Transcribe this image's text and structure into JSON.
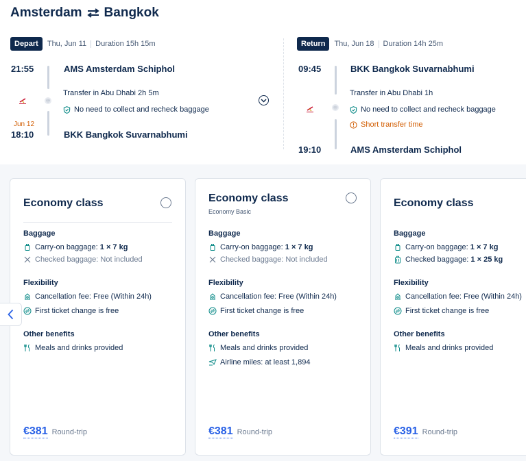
{
  "route": {
    "origin": "Amsterdam",
    "destination": "Bangkok",
    "swap_icon": "swap-arrows-icon"
  },
  "depart": {
    "badge": "Depart",
    "date": "Thu, Jun 11",
    "duration": "Duration 15h 15m",
    "dep_time": "21:55",
    "dep_airport": "AMS Amsterdam Schiphol",
    "transfer": "Transfer in Abu Dhabi  2h 5m",
    "baggage_note": "No need to collect and recheck baggage",
    "arr_nextday": "Jun 12",
    "arr_time": "18:10",
    "arr_airport": "BKK Bangkok Suvarnabhumi"
  },
  "return": {
    "badge": "Return",
    "date": "Thu, Jun 18",
    "duration": "Duration 14h 25m",
    "dep_time": "09:45",
    "dep_airport": "BKK Bangkok Suvarnabhumi",
    "transfer": "Transfer in Abu Dhabi  1h",
    "baggage_note": "No need to collect and recheck baggage",
    "warning": "Short transfer time",
    "arr_time": "19:10",
    "arr_airport": "AMS Amsterdam Schiphol"
  },
  "cards": [
    {
      "title": "Economy class",
      "subtitle": "",
      "baggage_head": "Baggage",
      "carry_label": "Carry-on baggage: ",
      "carry_value": "1 × 7 kg",
      "checked_label": "Checked baggage: Not included",
      "checked_value": "",
      "flex_head": "Flexibility",
      "cancel": "Cancellation fee: Free (Within 24h)",
      "change": "First ticket change is free",
      "other_head": "Other benefits",
      "meals": "Meals and drinks provided",
      "miles": "",
      "price": "€381",
      "price_note": "Round-trip"
    },
    {
      "title": "Economy class",
      "subtitle": "Economy Basic",
      "baggage_head": "Baggage",
      "carry_label": "Carry-on baggage: ",
      "carry_value": "1 × 7 kg",
      "checked_label": "Checked baggage: Not included",
      "checked_value": "",
      "flex_head": "Flexibility",
      "cancel": "Cancellation fee: Free (Within 24h)",
      "change": "First ticket change is free",
      "other_head": "Other benefits",
      "meals": "Meals and drinks provided",
      "miles": "Airline miles: at least 1,894",
      "price": "€381",
      "price_note": "Round-trip"
    },
    {
      "title": "Economy class",
      "subtitle": "",
      "baggage_head": "Baggage",
      "carry_label": "Carry-on baggage: ",
      "carry_value": "1 × 7 kg",
      "checked_label": "Checked baggage: ",
      "checked_value": "1 × 25 kg",
      "flex_head": "Flexibility",
      "cancel": "Cancellation fee: Free (Within 24h)",
      "change": "First ticket change is free",
      "other_head": "Other benefits",
      "meals": "Meals and drinks provided",
      "miles": "",
      "price": "€391",
      "price_note": "Round-trip"
    }
  ],
  "colors": {
    "navy": "#0f294d",
    "price_blue": "#2961e6",
    "warning": "#d15c00",
    "shield_teal": "#0a8a87"
  }
}
